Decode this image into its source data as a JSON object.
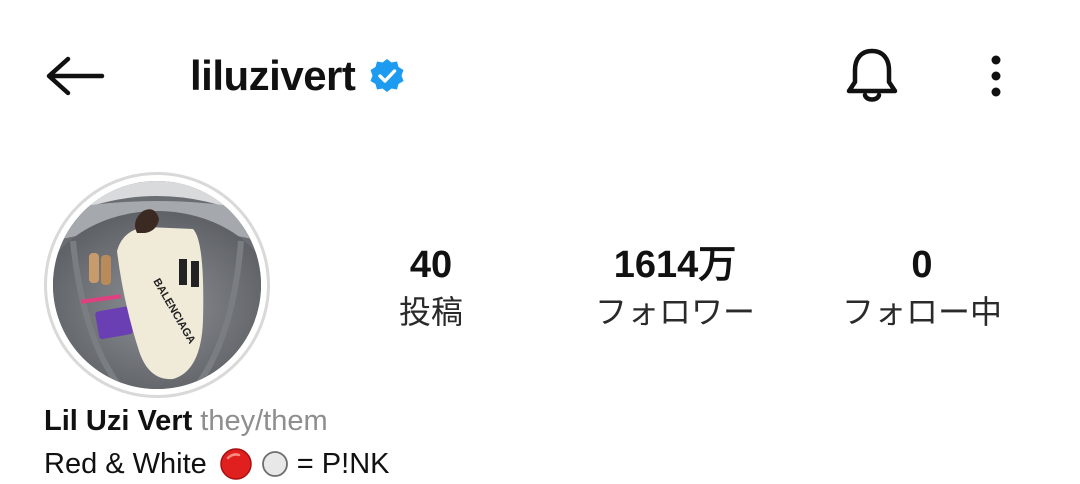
{
  "header": {
    "username": "liluzivert",
    "back_icon": "arrow-left-icon",
    "verified_icon": "verified-badge-icon",
    "notification_icon": "bell-icon",
    "more_icon": "more-vertical-icon"
  },
  "stats": {
    "posts": {
      "count": "40",
      "label": "投稿"
    },
    "followers": {
      "count": "1614万",
      "label": "フォロワー"
    },
    "following": {
      "count": "0",
      "label": "フォロー中"
    }
  },
  "bio": {
    "display_name": "Lil Uzi Vert",
    "pronouns": "they/them",
    "text_start": "Red & White",
    "text_end": "= P!NK",
    "emoji": [
      "red-circle-icon",
      "white-circle-icon"
    ]
  },
  "colors": {
    "verified": "#1d9bf0",
    "text": "#111111",
    "muted": "#8e8e8e",
    "emoji_red": "#e0201f"
  }
}
